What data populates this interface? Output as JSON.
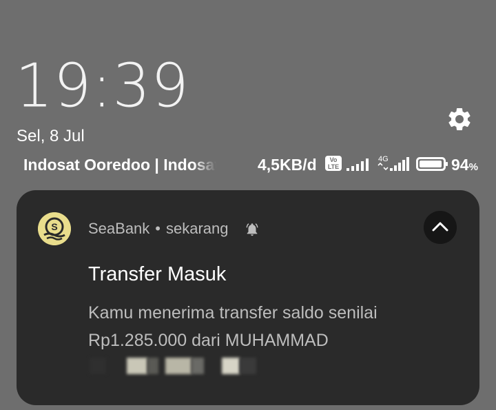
{
  "lockscreen": {
    "time": "19:39",
    "date": "Sel, 8 Jul"
  },
  "status_bar": {
    "carrier": "Indosat Ooredoo | Indosat",
    "network_speed": "4,5KB/d",
    "volte_label_top": "Vo",
    "volte_label_bottom": "LTE",
    "network_type": "4G",
    "battery_level": "94",
    "battery_unit": "%",
    "battery_fill_fraction": 0.94
  },
  "notification": {
    "app_name": "SeaBank",
    "separator": "•",
    "time": "sekarang",
    "title": "Transfer Masuk",
    "body_line1": "Kamu menerima transfer saldo senilai",
    "body_line2": "Rp1.285.000 dari MUHAMMAD"
  },
  "colors": {
    "background": "#6e6e6e",
    "card": "#2a2a2a",
    "app_icon": "#e9dd8c",
    "text_primary": "#ffffff",
    "text_secondary": "#bdbdbd"
  },
  "icons": {
    "settings": "gear-icon",
    "app": "seabank-logo-icon",
    "alert": "bell-ringing-icon",
    "collapse": "chevron-up-icon",
    "signal_sim1": "signal-bars-icon",
    "signal_sim2": "signal-bars-4g-icon",
    "battery": "battery-icon"
  }
}
